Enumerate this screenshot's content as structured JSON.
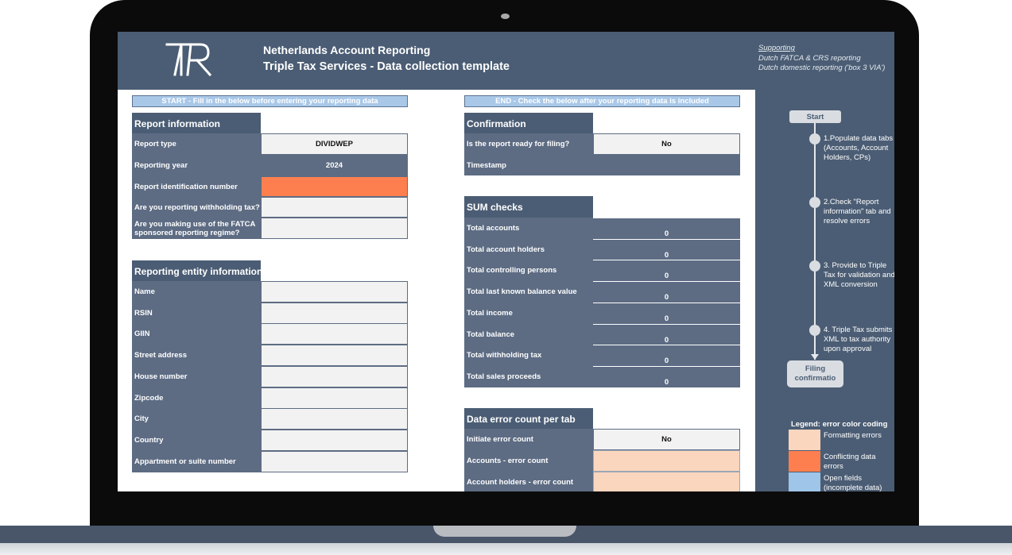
{
  "header": {
    "title_line1": "Netherlands Account Reporting",
    "title_line2": "Triple Tax Services - Data collection template",
    "supporting_label": "Supporting",
    "supporting_item1": "Dutch FATCA & CRS reporting",
    "supporting_item2": "Dutch domestic reporting ('box 3 VIA')"
  },
  "start_band": "START - Fill in the below before entering your reporting data",
  "end_band": "END - Check the below after your reporting data is included",
  "report_info": {
    "heading": "Report information",
    "rows": [
      {
        "label": "Report type",
        "value": "DIVIDWEP"
      },
      {
        "label": "Reporting year",
        "value": "2024"
      },
      {
        "label": "Report identification number",
        "value": ""
      },
      {
        "label": "Are you reporting withholding tax?",
        "value": ""
      },
      {
        "label": "Are you making use of the FATCA",
        "label2": "sponsored reporting regime?",
        "value": ""
      }
    ]
  },
  "entity_info": {
    "heading": "Reporting entity information",
    "rows": [
      "Name",
      "RSIN",
      "GIIN",
      "Street address",
      "House number",
      "Zipcode",
      "City",
      "Country",
      "Appartment or suite number"
    ]
  },
  "confirmation": {
    "heading": "Confirmation",
    "ready_label": "Is the report ready for filing?",
    "ready_value": "No",
    "timestamp_label": "Timestamp",
    "timestamp_value": ""
  },
  "sum_checks": {
    "heading": "SUM checks",
    "rows": [
      {
        "label": "Total accounts",
        "value": "0"
      },
      {
        "label": "Total account holders",
        "value": "0"
      },
      {
        "label": "Total controlling persons",
        "value": "0"
      },
      {
        "label": "Total last known balance value",
        "value": "0"
      },
      {
        "label": "Total income",
        "value": "0"
      },
      {
        "label": "Total balance",
        "value": "0"
      },
      {
        "label": "Total withholding tax",
        "value": "0"
      },
      {
        "label": "Total sales proceeds",
        "value": "0"
      }
    ]
  },
  "error_count": {
    "heading": "Data error count per tab",
    "rows": [
      {
        "label": "Initiate error count",
        "value": "No"
      },
      {
        "label": "Accounts - error count",
        "value": ""
      },
      {
        "label": "Account holders - error count",
        "value": ""
      }
    ]
  },
  "flow": {
    "start": "Start",
    "steps": [
      {
        "line1": "1.Populate data tabs",
        "line2": "(Accounts, Account",
        "line3": "Holders, CPs)"
      },
      {
        "line1": "2.Check \"Report",
        "line2": "information\" tab and",
        "line3": "resolve errors"
      },
      {
        "line1": "3. Provide to Triple",
        "line2": "Tax for validation and",
        "line3": "XML conversion"
      },
      {
        "line1": "4. Triple Tax submits",
        "line2": "XML to tax authority",
        "line3": "upon approval"
      }
    ],
    "end_line1": "Filing",
    "end_line2": "confirmatio"
  },
  "legend": {
    "title": "Legend: error color coding",
    "items": [
      {
        "line1": "Formatting errors",
        "line2": "",
        "color": "#fbd6be"
      },
      {
        "line1": "Conflicting data",
        "line2": "errors",
        "color": "#fd7f4f"
      },
      {
        "line1": "Open fields",
        "line2": "(incomplete data)",
        "color": "#9fc5e8"
      }
    ]
  },
  "colors": {
    "header": "#4b5d74",
    "label": "#5d6c83",
    "error_orange": "#fd7f4f",
    "error_peach": "#fbd6be",
    "open_blue": "#9fc5e8"
  }
}
